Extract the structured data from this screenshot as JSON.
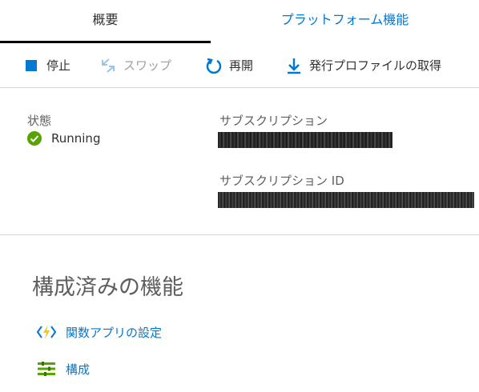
{
  "tabs": {
    "overview": "概要",
    "platform": "プラットフォーム機能"
  },
  "toolbar": {
    "stop_label": "停止",
    "swap_label": "スワップ",
    "restart_label": "再開",
    "profile_label": "発行プロファイルの取得",
    "stop_icon": "stop-square-icon",
    "swap_icon": "swap-arrows-icon",
    "restart_icon": "restart-icon",
    "profile_icon": "download-icon"
  },
  "info": {
    "status_label": "状態",
    "status_value": "Running",
    "status_icon": "check-circle-icon",
    "subscription_label": "サブスクリプション",
    "subscription_id_label": "サブスクリプション ID"
  },
  "features": {
    "title": "構成済みの機能",
    "items": [
      {
        "label": "関数アプリの設定",
        "icon": "function-app-icon"
      },
      {
        "label": "構成",
        "icon": "configuration-icon"
      }
    ]
  },
  "colors": {
    "accent": "#0078d4",
    "success": "#57a300",
    "text": "#323130",
    "muted": "#605e5c",
    "disabled": "#a19f9d",
    "divider": "#d6d6d6"
  }
}
